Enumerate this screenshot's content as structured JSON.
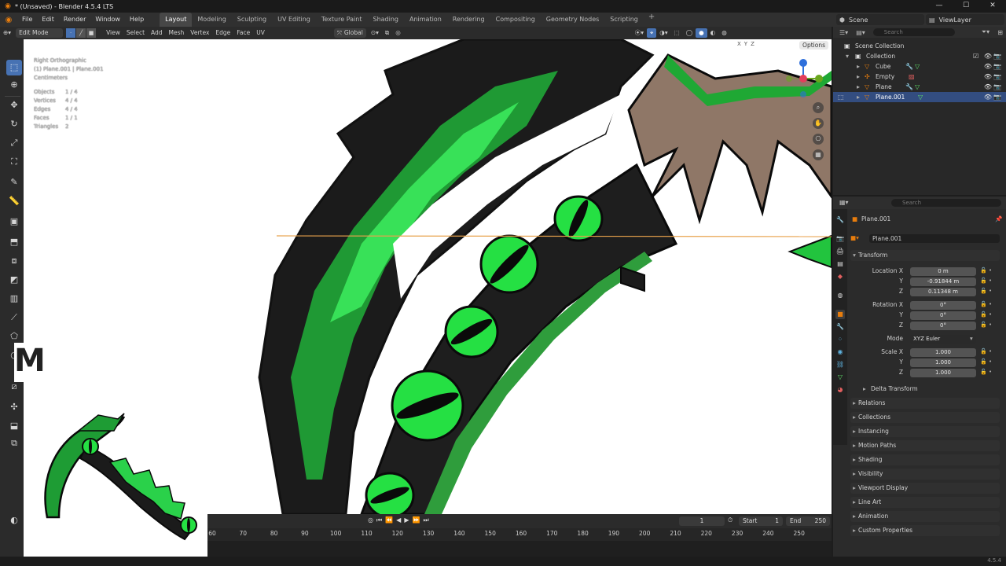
{
  "titlebar": {
    "title": "* (Unsaved) - Blender 4.5.4 LTS",
    "minimize": "—",
    "maximize": "☐",
    "close": "✕"
  },
  "menu": {
    "file": "File",
    "edit": "Edit",
    "render": "Render",
    "window": "Window",
    "help": "Help"
  },
  "workspaces": [
    "Layout",
    "Modeling",
    "Sculpting",
    "UV Editing",
    "Texture Paint",
    "Shading",
    "Animation",
    "Rendering",
    "Compositing",
    "Geometry Nodes",
    "Scripting"
  ],
  "add_workspace": "+",
  "scene": {
    "label": "Scene",
    "view_layer": "ViewLayer"
  },
  "viewport_header": {
    "mode": "Edit Mode",
    "view": "View",
    "select": "Select",
    "add": "Add",
    "mesh": "Mesh",
    "vertex": "Vertex",
    "edge": "Edge",
    "face": "Face",
    "uv": "UV",
    "orientation": "Global",
    "options": "Options",
    "axes": [
      "X",
      "Y",
      "Z"
    ]
  },
  "viewport_overlay": {
    "view_name": "Right Orthographic",
    "object_path": "(1) Plane.001 | Plane.001",
    "unit": "Centimeters",
    "stats": [
      {
        "k": "Objects",
        "v": "1 / 4"
      },
      {
        "k": "Vertices",
        "v": "4 / 4"
      },
      {
        "k": "Edges",
        "v": "4 / 4"
      },
      {
        "k": "Faces",
        "v": "1 / 1"
      },
      {
        "k": "Triangles",
        "v": "2"
      }
    ]
  },
  "overlay_letter": "M",
  "timeline": {
    "current_frame": "1",
    "start_label": "Start",
    "start": "1",
    "end_label": "End",
    "end": "250",
    "ticks": [
      "60",
      "70",
      "80",
      "90",
      "100",
      "110",
      "120",
      "130",
      "140",
      "150",
      "160",
      "170",
      "180",
      "190",
      "200",
      "210",
      "220",
      "230",
      "240",
      "250"
    ]
  },
  "outliner": {
    "search_placeholder": "Search",
    "rows": [
      {
        "name": "Scene Collection",
        "icon": "scene-collection-icon"
      },
      {
        "name": "Collection",
        "icon": "collection-icon"
      },
      {
        "name": "Cube",
        "icon": "mesh-object-icon"
      },
      {
        "name": "Empty",
        "icon": "empty-object-icon"
      },
      {
        "name": "Plane",
        "icon": "mesh-object-icon"
      },
      {
        "name": "Plane.001",
        "icon": "mesh-object-icon"
      }
    ]
  },
  "properties": {
    "search_placeholder": "Search",
    "object_name": "Plane.001",
    "object_field": "Plane.001",
    "transform_label": "Transform",
    "location_x_label": "Location X",
    "location_x": "0 m",
    "location_y_label": "Y",
    "location_y": "-0.91844 m",
    "location_z_label": "Z",
    "location_z": "0.11348 m",
    "rotation_x_label": "Rotation X",
    "rotation_x": "0°",
    "rotation_y_label": "Y",
    "rotation_y": "0°",
    "rotation_z_label": "Z",
    "rotation_z": "0°",
    "mode_label": "Mode",
    "mode": "XYZ Euler",
    "scale_x_label": "Scale X",
    "scale_x": "1.000",
    "scale_y_label": "Y",
    "scale_y": "1.000",
    "scale_z_label": "Z",
    "scale_z": "1.000",
    "panels": [
      "Delta Transform",
      "Relations",
      "Collections",
      "Instancing",
      "Motion Paths",
      "Shading",
      "Visibility",
      "Viewport Display",
      "Line Art",
      "Animation",
      "Custom Properties"
    ]
  },
  "status": {
    "version": "4.5.4"
  },
  "colors": {
    "accent_blue": "#4772b3",
    "blender_orange": "#e87d0d",
    "art_green": "#1fd43a",
    "art_dark": "#1e1e1e",
    "art_brown": "#8f7767"
  }
}
